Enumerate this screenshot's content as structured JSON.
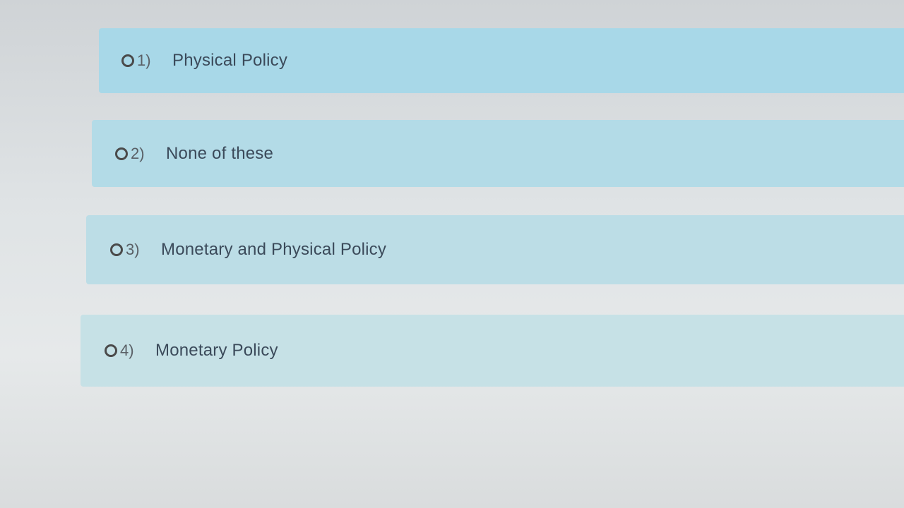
{
  "options": [
    {
      "number": "1)",
      "label": "Physical Policy"
    },
    {
      "number": "2)",
      "label": "None of these"
    },
    {
      "number": "3)",
      "label": "Monetary and Physical Policy"
    },
    {
      "number": "4)",
      "label": "Monetary Policy"
    }
  ],
  "colors": {
    "option_bg": "#a8d8e8",
    "radio_border": "#4a4a4a",
    "text": "#3b4a5a"
  }
}
